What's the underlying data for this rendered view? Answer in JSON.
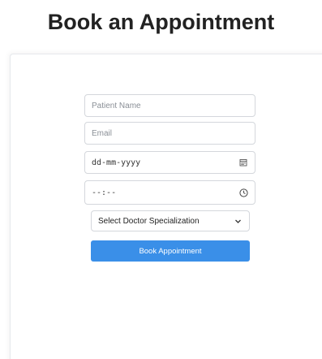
{
  "page": {
    "title": "Book an Appointment"
  },
  "form": {
    "patient_name_placeholder": "Patient Name",
    "email_placeholder": "Email",
    "date_placeholder": "dd-mm-yyyy",
    "time_placeholder": "--:--",
    "specialization_selected": "Select Doctor Specialization",
    "submit_label": "Book Appointment"
  },
  "icons": {
    "calendar": "calendar-icon",
    "clock": "clock-icon",
    "dropdown": "chevron-down-icon"
  },
  "colors": {
    "accent": "#3a8fe8",
    "border": "#d4d7dc",
    "title": "#222222"
  }
}
